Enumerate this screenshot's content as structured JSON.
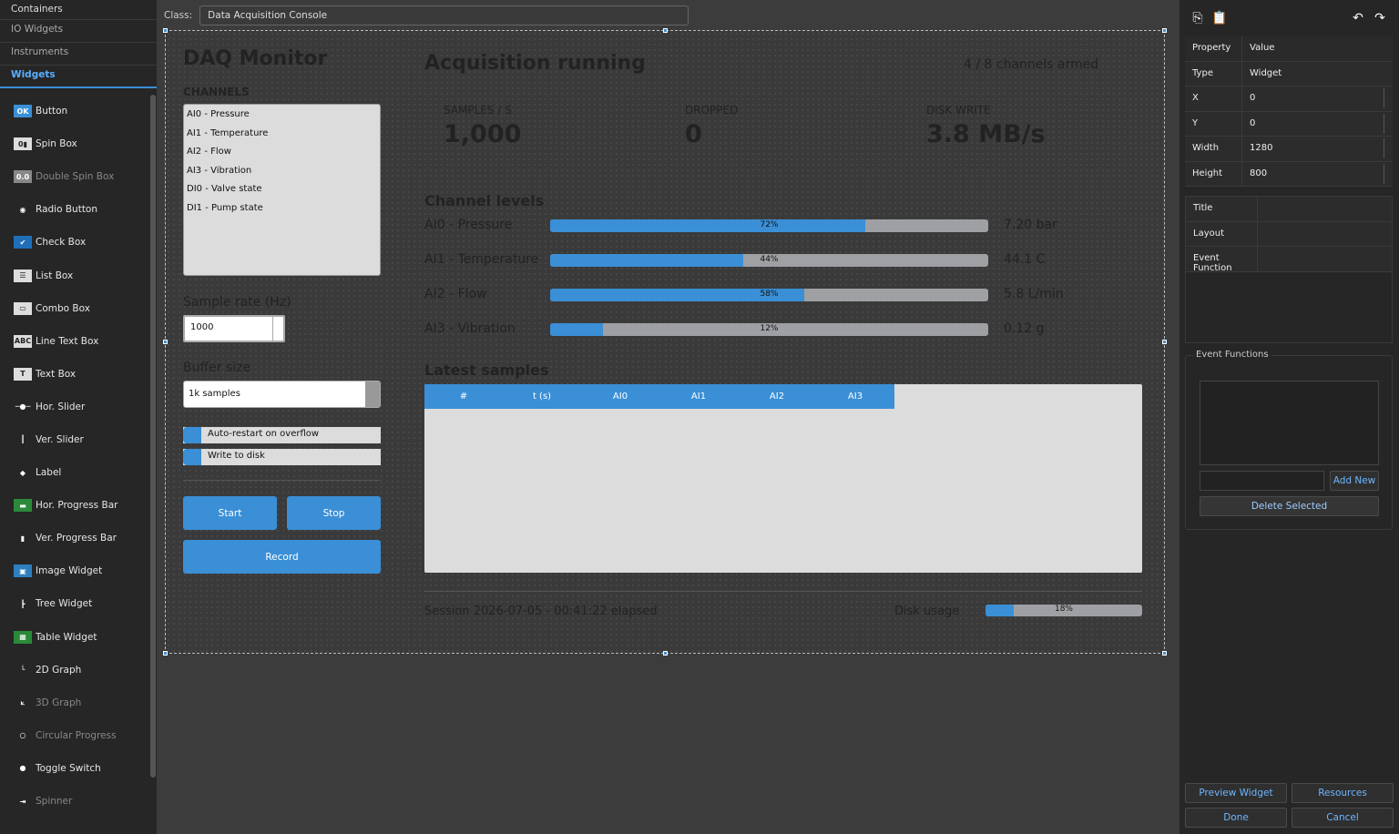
{
  "palette": {
    "categories": [
      "Containers",
      "IO Widgets",
      "Instruments",
      "Widgets"
    ],
    "items": [
      {
        "label": "Button",
        "icon": "button-icon",
        "dim": false
      },
      {
        "label": "Spin Box",
        "icon": "spinbox-icon",
        "dim": false
      },
      {
        "label": "Double Spin Box",
        "icon": "double-spinbox-icon",
        "dim": true
      },
      {
        "label": "Radio Button",
        "icon": "radio-icon",
        "dim": false
      },
      {
        "label": "Check Box",
        "icon": "checkbox-icon",
        "dim": false
      },
      {
        "label": "List Box",
        "icon": "listbox-icon",
        "dim": false
      },
      {
        "label": "Combo Box",
        "icon": "combobox-icon",
        "dim": false
      },
      {
        "label": "Line Text Box",
        "icon": "linetext-icon",
        "dim": false
      },
      {
        "label": "Text Box",
        "icon": "textbox-icon",
        "dim": false
      },
      {
        "label": "Hor. Slider",
        "icon": "hslider-icon",
        "dim": false
      },
      {
        "label": "Ver. Slider",
        "icon": "vslider-icon",
        "dim": false
      },
      {
        "label": "Label",
        "icon": "label-icon",
        "dim": false
      },
      {
        "label": "Hor. Progress Bar",
        "icon": "hprogress-icon",
        "dim": false
      },
      {
        "label": "Ver. Progress Bar",
        "icon": "vprogress-icon",
        "dim": false
      },
      {
        "label": "Image Widget",
        "icon": "image-icon",
        "dim": false
      },
      {
        "label": "Tree Widget",
        "icon": "tree-icon",
        "dim": false
      },
      {
        "label": "Table Widget",
        "icon": "table-icon",
        "dim": false
      },
      {
        "label": "2D Graph",
        "icon": "graph2d-icon",
        "dim": false
      },
      {
        "label": "3D Graph",
        "icon": "graph3d-icon",
        "dim": true
      },
      {
        "label": "Circular Progress",
        "icon": "circular-icon",
        "dim": true
      },
      {
        "label": "Toggle Switch",
        "icon": "toggle-icon",
        "dim": false
      },
      {
        "label": "Spinner",
        "icon": "spinner-icon",
        "dim": true
      }
    ]
  },
  "classbar": {
    "label": "Class:",
    "value": "Data Acquisition Console"
  },
  "widget": {
    "title": "DAQ Monitor",
    "channels_label": "CHANNELS",
    "channels": [
      "AI0 - Pressure",
      "AI1 - Temperature",
      "AI2 - Flow",
      "AI3 - Vibration",
      "DI0 - Valve state",
      "DI1 - Pump state"
    ],
    "sample_rate_label": "Sample rate (Hz)",
    "sample_rate_value": "1000",
    "buffer_label": "Buffer size",
    "buffer_value": "1k samples",
    "toggle_overflow": "Auto-restart on overflow",
    "toggle_write": "Write to disk",
    "start_label": "Start",
    "stop_label": "Stop",
    "record_label": "Record",
    "status": "Acquisition running",
    "armed": "4 / 8 channels armed",
    "stats": [
      {
        "label": "SAMPLES / S",
        "value": "1,000"
      },
      {
        "label": "DROPPED",
        "value": "0"
      },
      {
        "label": "DISK WRITE",
        "value": "3.8 MB/s"
      }
    ],
    "levels_title": "Channel levels",
    "levels": [
      {
        "name": "AI0 - Pressure",
        "pct": 72,
        "pct_label": "72%",
        "value": "7.20 bar"
      },
      {
        "name": "AI1 - Temperature",
        "pct": 44,
        "pct_label": "44%",
        "value": "44.1 C"
      },
      {
        "name": "AI2 - Flow",
        "pct": 58,
        "pct_label": "58%",
        "value": "5.8 L/min"
      },
      {
        "name": "AI3 - Vibration",
        "pct": 12,
        "pct_label": "12%",
        "value": "0.12 g"
      }
    ],
    "samples_title": "Latest samples",
    "columns": [
      "#",
      "t (s)",
      "AI0",
      "AI1",
      "AI2",
      "AI3"
    ],
    "session": "Session 2026-07-05  -  00:41:22 elapsed",
    "disk_label": "Disk usage",
    "disk_pct": 18,
    "disk_pct_label": "18%"
  },
  "properties": {
    "header": {
      "k": "Property",
      "v": "Value"
    },
    "rows": [
      {
        "k": "Type",
        "v": "Widget",
        "spin": false
      },
      {
        "k": "X",
        "v": "0",
        "spin": true
      },
      {
        "k": "Y",
        "v": "0",
        "spin": true
      },
      {
        "k": "Width",
        "v": "1280",
        "spin": true
      },
      {
        "k": "Height",
        "v": "800",
        "spin": true
      }
    ],
    "rows2": [
      {
        "k": "Title",
        "v": ""
      },
      {
        "k": "Layout",
        "v": ""
      },
      {
        "k": "Event Function",
        "v": ""
      }
    ]
  },
  "event_functions": {
    "label": "Event Functions",
    "add_new": "Add New",
    "delete_selected": "Delete Selected"
  },
  "footer": {
    "preview": "Preview Widget",
    "resources": "Resources",
    "done": "Done",
    "cancel": "Cancel"
  },
  "colors": {
    "accent": "#3a8fd6",
    "bar_track": "#9ea0a3"
  }
}
